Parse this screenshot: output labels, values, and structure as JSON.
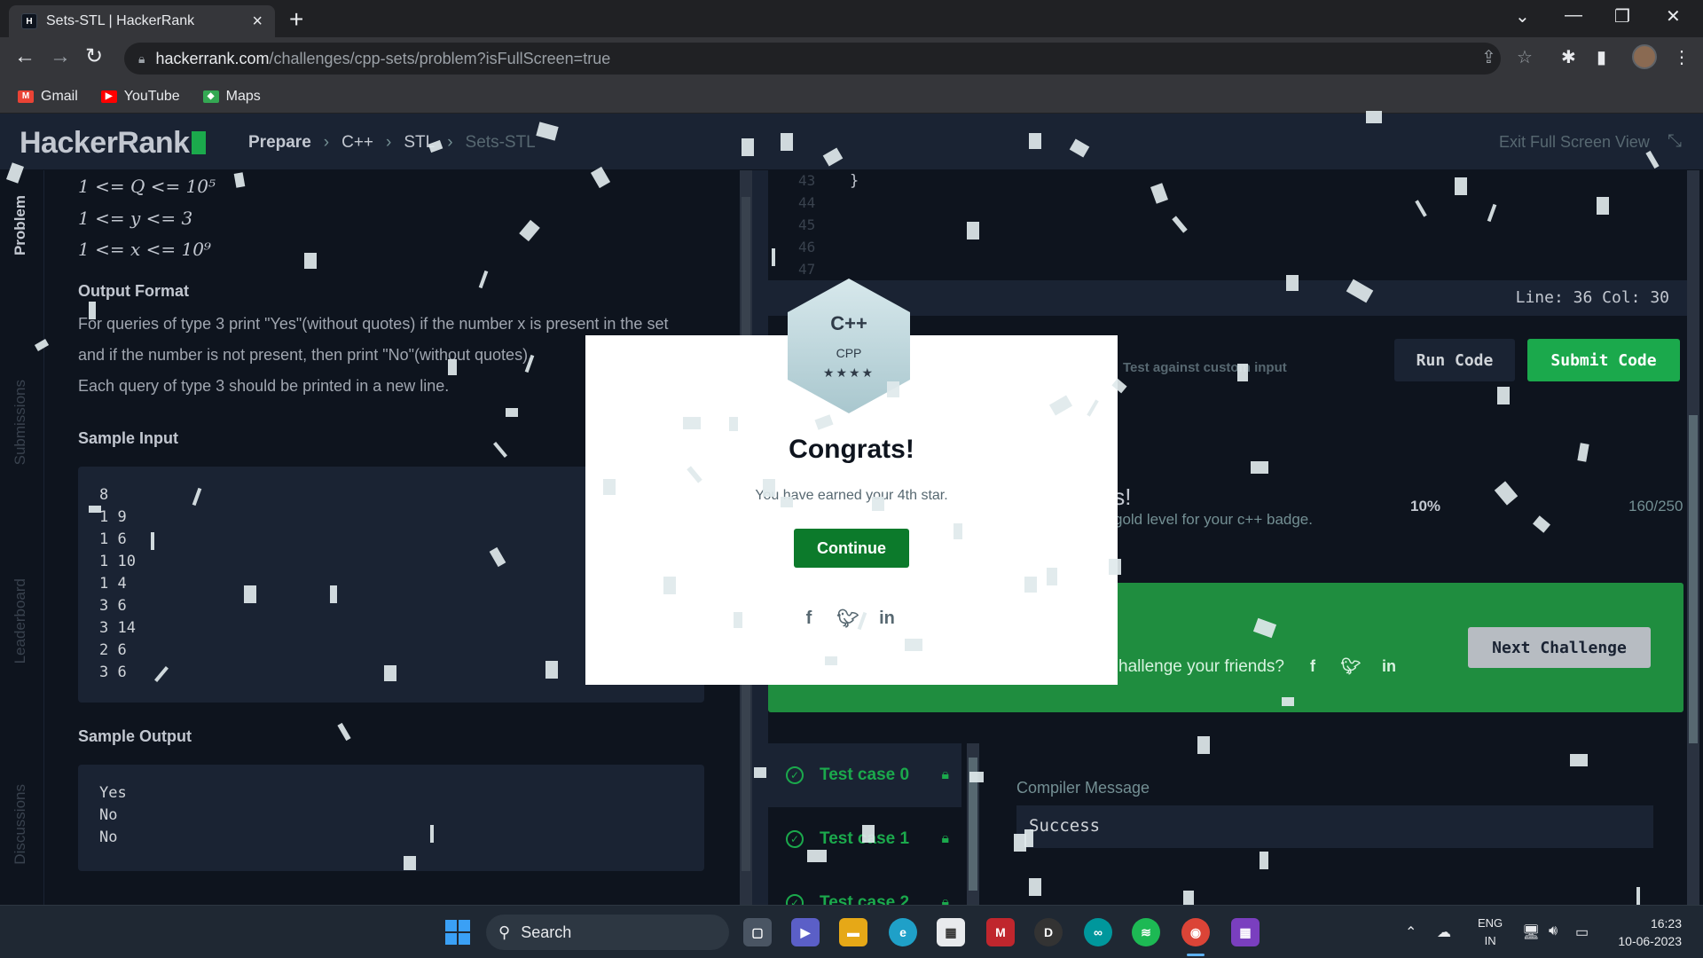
{
  "browser": {
    "tab_title": "Sets-STL | HackerRank",
    "url_host": "hackerrank.com",
    "url_path": "/challenges/cpp-sets/problem?isFullScreen=true",
    "bookmarks": [
      "Gmail",
      "YouTube",
      "Maps"
    ]
  },
  "header": {
    "logo": "HackerRank",
    "breadcrumb": [
      "Prepare",
      "C++",
      "STL",
      "Sets-STL"
    ],
    "exit_fullscreen": "Exit Full Screen View"
  },
  "sidebar_tabs": [
    "Problem",
    "Submissions",
    "Leaderboard",
    "Discussions"
  ],
  "problem": {
    "constraints": [
      "1 <= Q <= 10⁵",
      "1 <= y <= 3",
      "1 <= x <= 10⁹"
    ],
    "output_format_title": "Output Format",
    "output_format_lines": [
      "For queries of type 3 print \"Yes\"(without quotes) if the number x is present in the set",
      "and if the number is not present, then print \"No\"(without quotes).",
      "Each query of type 3 should be printed in a new line."
    ],
    "sample_input_title": "Sample Input",
    "sample_input": [
      "8",
      "1 9",
      "1 6",
      "1 10",
      "1 4",
      "3 6",
      "3 14",
      "2 6",
      "3 6"
    ],
    "sample_output_title": "Sample Output",
    "sample_output": [
      "Yes",
      "No",
      "No"
    ]
  },
  "editor": {
    "line_numbers": [
      "43",
      "44",
      "45",
      "46",
      "47"
    ],
    "code_line": "}",
    "cursor": "Line: 36 Col: 30",
    "custom_input": "Test against custom input",
    "run": "Run Code",
    "submit": "Submit Code"
  },
  "result": {
    "title": "ts!",
    "subtitle": "gold level for your c++ badge.",
    "percent": "10%",
    "count": "160/250",
    "challenge": "hallenge your friends?",
    "next": "Next Challenge"
  },
  "testcases": [
    "Test case 0",
    "Test case 1",
    "Test case 2"
  ],
  "compiler": {
    "label": "Compiler Message",
    "value": "Success"
  },
  "modal": {
    "badge_symbol": "C++",
    "badge_lang": "CPP",
    "badge_stars": "★★★★",
    "title": "Congrats!",
    "message": "You have earned your 4th star.",
    "continue": "Continue"
  },
  "taskbar": {
    "search": "Search",
    "lang_1": "ENG",
    "lang_2": "IN",
    "time": "16:23",
    "date": "10-06-2023"
  },
  "colors": {
    "accent_green": "#1ba94c",
    "panel_dark": "#0e141e",
    "panel_mid": "#1a2333"
  }
}
